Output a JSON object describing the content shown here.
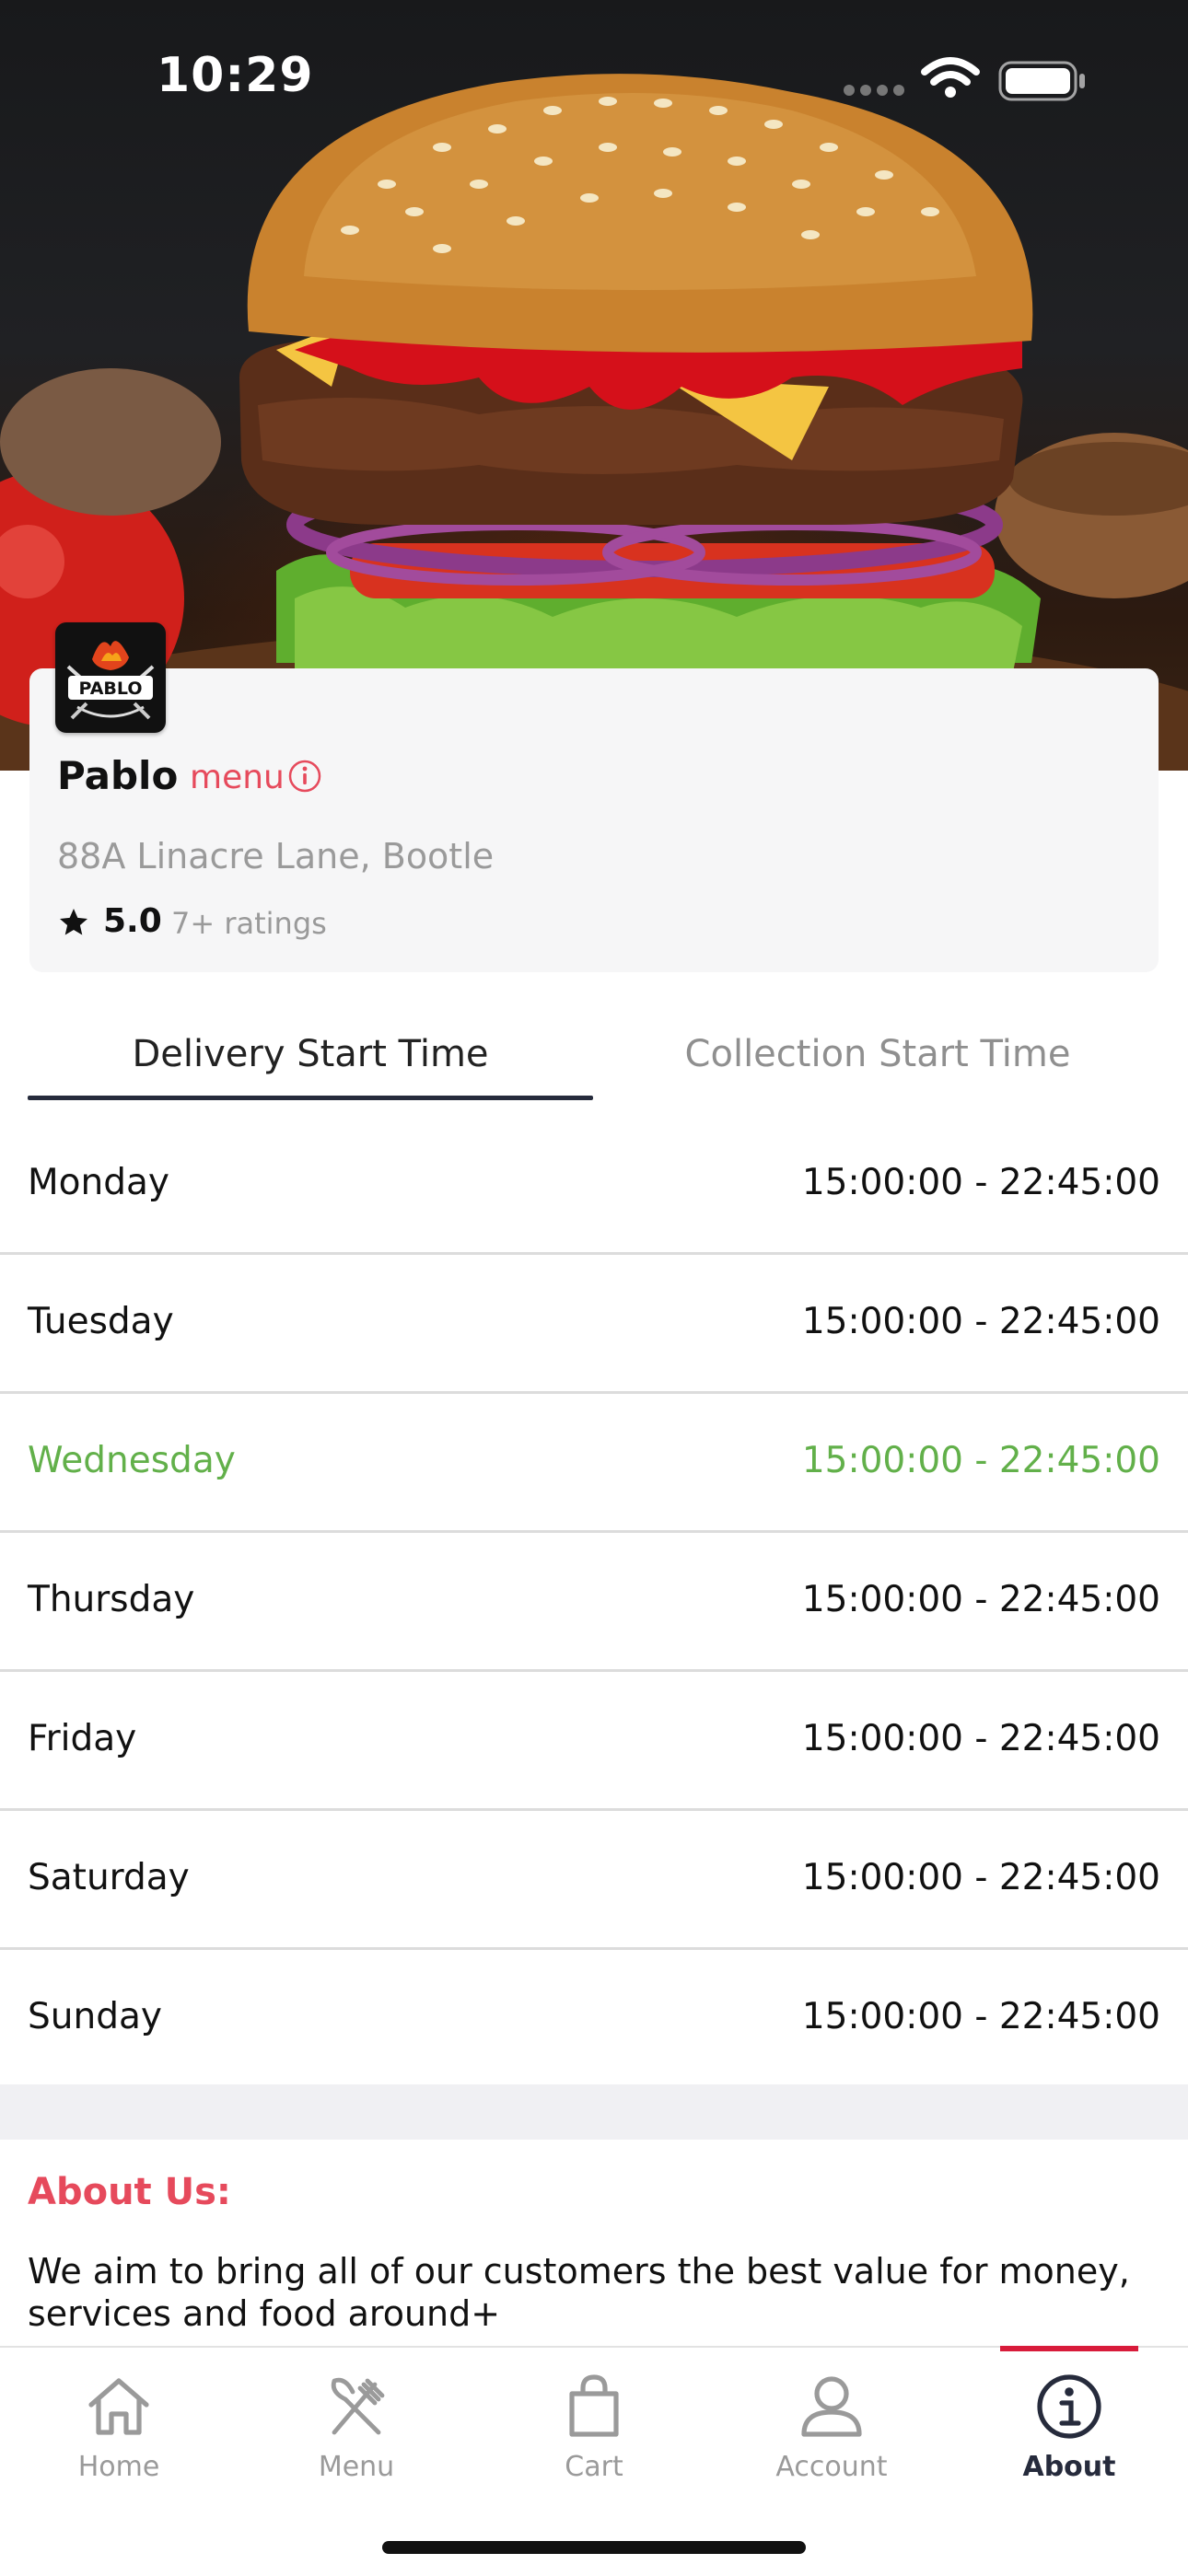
{
  "status_bar": {
    "time": "10:29"
  },
  "store": {
    "logo_text": "PABLO",
    "name": "Pablo",
    "menu_label": "menu",
    "address": "88A Linacre Lane, Bootle",
    "rating": "5.0",
    "rating_count": "7+ ratings"
  },
  "tabs": [
    {
      "label": "Delivery Start Time",
      "active": true
    },
    {
      "label": "Collection Start Time",
      "active": false
    }
  ],
  "schedule": [
    {
      "day": "Monday",
      "hours": "15:00:00 - 22:45:00"
    },
    {
      "day": "Tuesday",
      "hours": "15:00:00 - 22:45:00"
    },
    {
      "day": "Wednesday",
      "hours": "15:00:00 - 22:45:00",
      "today": true
    },
    {
      "day": "Thursday",
      "hours": "15:00:00 - 22:45:00"
    },
    {
      "day": "Friday",
      "hours": "15:00:00 - 22:45:00"
    },
    {
      "day": "Saturday",
      "hours": "15:00:00 - 22:45:00"
    },
    {
      "day": "Sunday",
      "hours": "15:00:00 - 22:45:00"
    }
  ],
  "about": {
    "title": "About Us:",
    "text": "We aim to bring all of our customers the best value for money, services and food around+"
  },
  "tab_bar": [
    {
      "label": "Home",
      "icon": "home-icon"
    },
    {
      "label": "Menu",
      "icon": "utensils-icon"
    },
    {
      "label": "Cart",
      "icon": "bag-icon"
    },
    {
      "label": "Account",
      "icon": "user-icon"
    },
    {
      "label": "About",
      "icon": "info-icon",
      "active": true
    }
  ],
  "colors": {
    "accent": "#e64a5c",
    "today": "#62b04a",
    "tab_active": "#262b3c",
    "tab_bar_indicator": "#d81b3a"
  }
}
